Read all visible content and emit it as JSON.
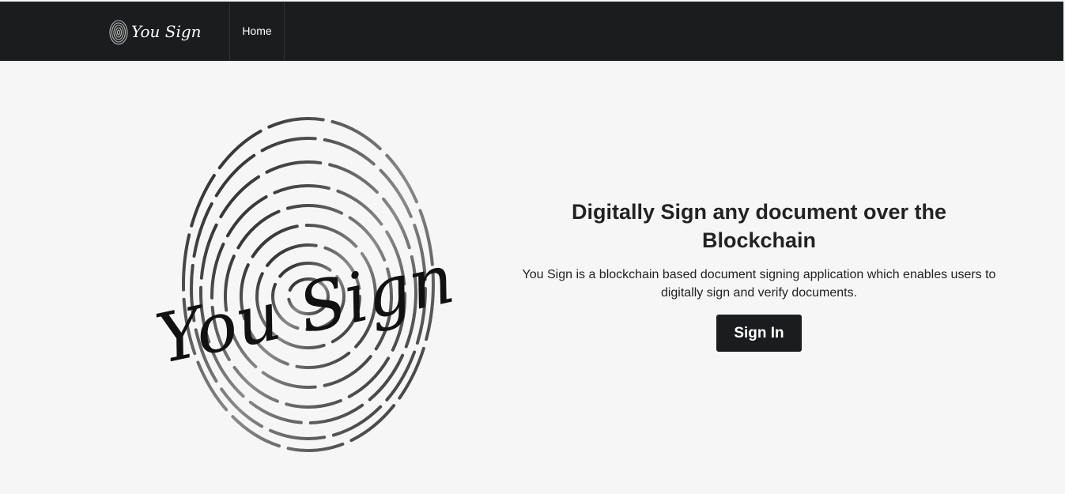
{
  "nav": {
    "brand": "You Sign",
    "items": [
      {
        "label": "Home"
      }
    ]
  },
  "hero": {
    "logo_text": "You Sign",
    "title": "Digitally Sign any document over the Blockchain",
    "description": "You Sign is a blockchain based document signing application which enables users to digitally sign and verify documents.",
    "cta_label": "Sign In"
  },
  "colors": {
    "nav_bg": "#1b1c1d",
    "page_bg": "#f6f6f6",
    "button_bg": "#1b1c1d",
    "text": "#222222"
  }
}
